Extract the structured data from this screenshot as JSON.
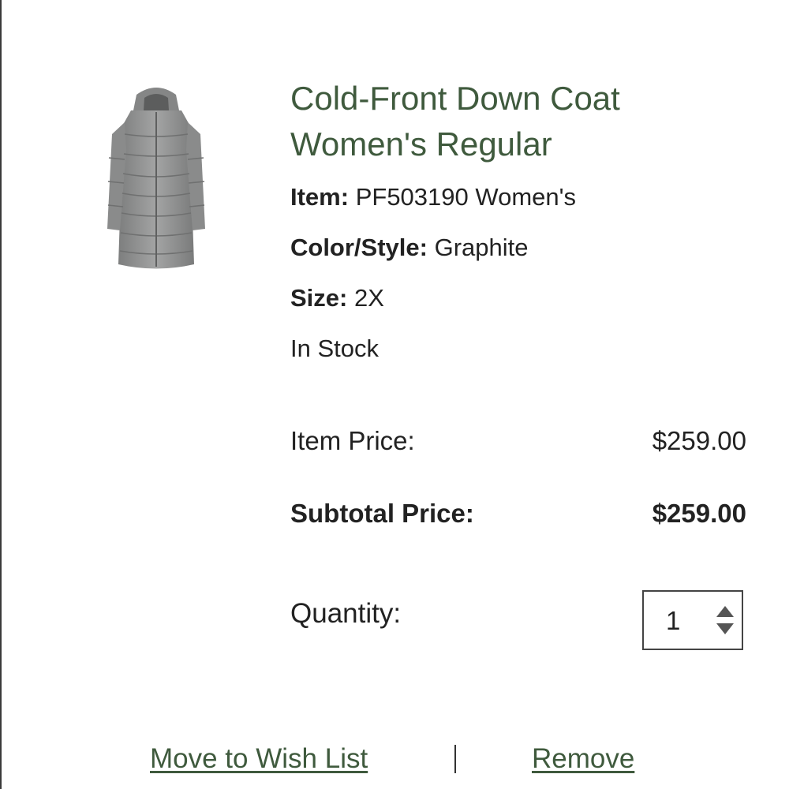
{
  "product": {
    "title_line1": "Cold-Front Down Coat",
    "title_line2": "Women's Regular",
    "image_icon": "down-coat-image",
    "item_label": "Item:",
    "item_value": "PF503190 Women's",
    "color_label": "Color/Style:",
    "color_value": "Graphite",
    "size_label": "Size:",
    "size_value": "2X",
    "stock_status": "In Stock"
  },
  "pricing": {
    "item_price_label": "Item Price:",
    "item_price_value": "$259.00",
    "subtotal_label": "Subtotal Price:",
    "subtotal_value": "$259.00"
  },
  "quantity": {
    "label": "Quantity:",
    "value": "1"
  },
  "actions": {
    "wishlist_label": "Move to Wish List",
    "remove_label": "Remove"
  },
  "colors": {
    "accent_green": "#3f5a3d",
    "text": "#222222",
    "coat_gray": "#8f9090"
  }
}
